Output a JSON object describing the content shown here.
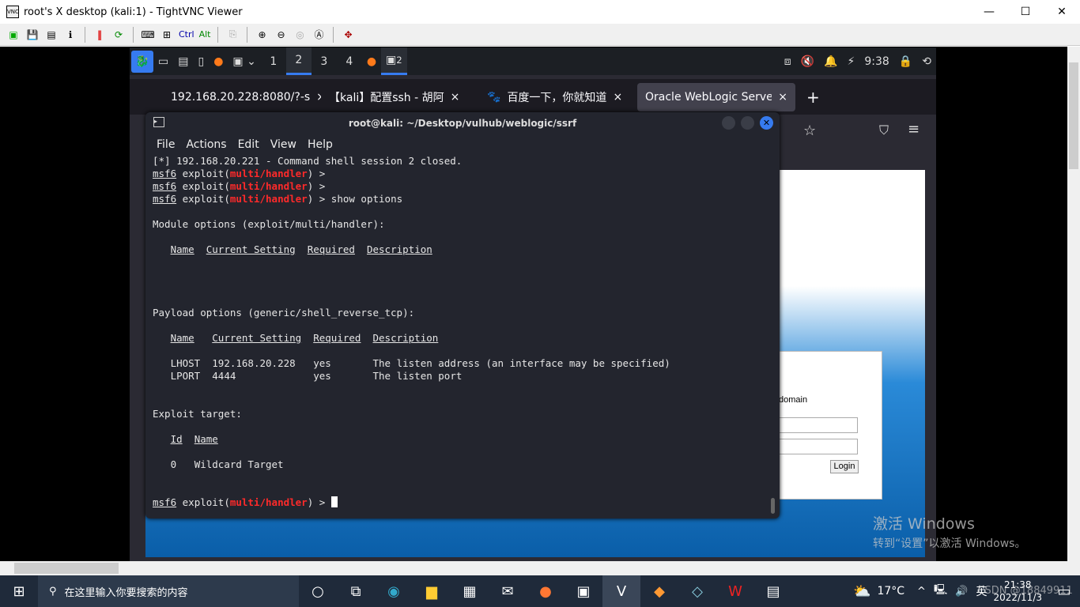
{
  "window": {
    "title": "root's X desktop (kali:1) - TightVNC Viewer",
    "minimize": "—",
    "maximize": "☐",
    "close": "✕"
  },
  "vnc_toolbar": {
    "ctrl": "Ctrl",
    "alt": "Alt"
  },
  "kali_panel": {
    "workspaces": [
      "1",
      "2",
      "3",
      "4"
    ],
    "active_workspace": "2",
    "clock": "9:38",
    "terminal_badge": "2"
  },
  "firefox": {
    "tabs": [
      {
        "label": "192.168.20.228:8080/?-s"
      },
      {
        "label": "【kali】配置ssh - 胡阿"
      },
      {
        "label": "百度一下，你就知道"
      },
      {
        "label": "Oracle WebLogic Server A",
        "selected": true
      }
    ],
    "new_tab": "+",
    "page": {
      "domain_text": "domain",
      "login_button": "Login"
    }
  },
  "terminal": {
    "title": "root@kali: ~/Desktop/vulhub/weblogic/ssrf",
    "menu": [
      "File",
      "Actions",
      "Edit",
      "View",
      "Help"
    ],
    "prompt_user": "msf6",
    "prompt_cmd": "exploit(",
    "prompt_module": "multi/handler",
    "prompt_end": ") >",
    "session_closed": "[*] 192.168.20.221 - Command shell session 2 closed.",
    "show_options": " show options",
    "module_options": "Module options (exploit/multi/handler):",
    "payload_options": "Payload options (generic/shell_reverse_tcp):",
    "module_headers": [
      "Name",
      "Current Setting",
      "Required",
      "Description"
    ],
    "payload_headers": [
      "Name",
      "Current Setting",
      "Required",
      "Description"
    ],
    "payload_rows": [
      [
        "LHOST",
        "192.168.20.228",
        "yes",
        "The listen address (an interface may be specified)"
      ],
      [
        "LPORT",
        "4444",
        "yes",
        "The listen port"
      ]
    ],
    "exploit_target": "Exploit target:",
    "target_headers": [
      "Id",
      "Name"
    ],
    "target_rows": [
      [
        "0",
        "Wildcard Target"
      ]
    ]
  },
  "watermark": {
    "line1": "激活 Windows",
    "line2": "转到“设置”以激活 Windows。"
  },
  "taskbar": {
    "search_placeholder": "在这里输入你要搜索的内容",
    "weather": "17°C",
    "ime": "英",
    "time": "21:38",
    "date": "2022/11/3",
    "csdn": "CSDN @18849911"
  }
}
